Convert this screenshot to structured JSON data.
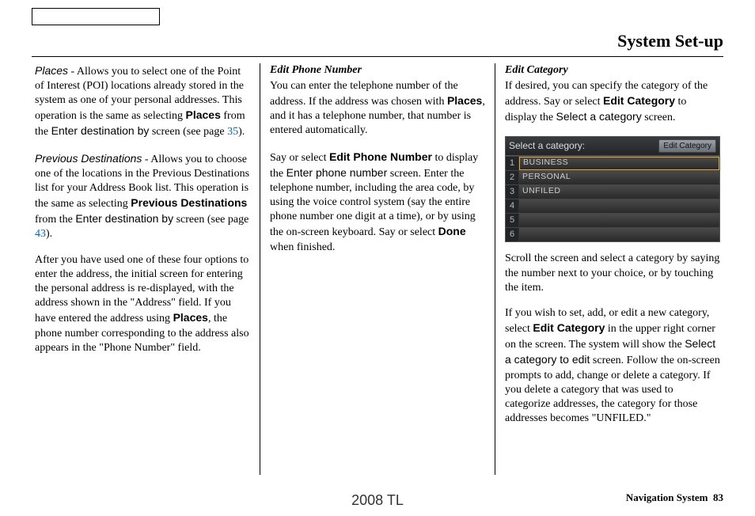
{
  "page_title": "System Set-up",
  "col1": {
    "places_label": "Places",
    "places_text_a": " - Allows you to select one of the Point of Interest (POI) locations already stored in the system as one of your personal addresses. This operation is the same as selecting ",
    "places_bold": "Places",
    "places_text_b": " from the ",
    "enter_dest": "Enter destination by",
    "places_text_c": " screen (see page ",
    "page35": "35",
    "places_text_d": ").",
    "prev_label": "Previous Destinations",
    "prev_text_a": " - Allows you to choose one of the locations in the Previous Destinations list for your Address Book list. This operation is the same as selecting ",
    "prev_bold": "Previous Destinations",
    "prev_text_b": " from the ",
    "prev_text_c": " screen (see page ",
    "page43": "43",
    "prev_text_d": ").",
    "after_a": "After you have used one of these four options to enter the address, the initial screen for entering the personal address is re-displayed, with the address shown in the \"Address\" field. If you have entered the address using ",
    "after_bold": "Places",
    "after_b": ", the phone number corresponding to the address also appears in the \"Phone Number\" field."
  },
  "col2": {
    "heading": "Edit Phone Number",
    "p1_a": "You can enter the telephone number of the address. If the address was chosen with ",
    "p1_bold": "Places",
    "p1_b": ", and it has a telephone number, that number is entered automatically.",
    "p2_a": "Say or select ",
    "p2_bold": "Edit Phone Number",
    "p2_b": " to display the ",
    "enter_phone": "Enter phone number",
    "p2_c": " screen. Enter the telephone number, including the area code, by using the voice control system (say the entire phone number one digit at a time), or by using the on-screen keyboard. Say or select ",
    "done_bold": "Done",
    "p2_d": " when finished."
  },
  "col3": {
    "heading": "Edit Category",
    "p1_a": "If desired, you can specify the category of the address. Say or select ",
    "p1_bold": "Edit Category",
    "p1_b": " to display the ",
    "select_cat": "Select a category",
    "p1_c": " screen.",
    "screen": {
      "title": "Select a category:",
      "button": "Edit Category",
      "rows": [
        {
          "n": "1",
          "label": "BUSINESS",
          "selected": true
        },
        {
          "n": "2",
          "label": "PERSONAL",
          "selected": false
        },
        {
          "n": "3",
          "label": "UNFILED",
          "selected": false
        },
        {
          "n": "4",
          "label": "",
          "selected": false
        },
        {
          "n": "5",
          "label": "",
          "selected": false
        },
        {
          "n": "6",
          "label": "",
          "selected": false
        }
      ]
    },
    "p2": "Scroll the screen and select a category by saying the number next to your choice, or by touching the item.",
    "p3_a": "If you wish to set, add, or edit a new category, select ",
    "p3_bold": "Edit Category",
    "p3_b": " in the upper right corner on the screen. The system will show the ",
    "select_edit": "Select a category to edit",
    "p3_c": " screen. Follow the on-screen prompts to add, change or delete a category. If you delete a category that was used to categorize addresses, the category for those addresses becomes \"UNFILED.\""
  },
  "footer": {
    "center": "2008  TL",
    "right_label": "Navigation System",
    "page": "83"
  }
}
